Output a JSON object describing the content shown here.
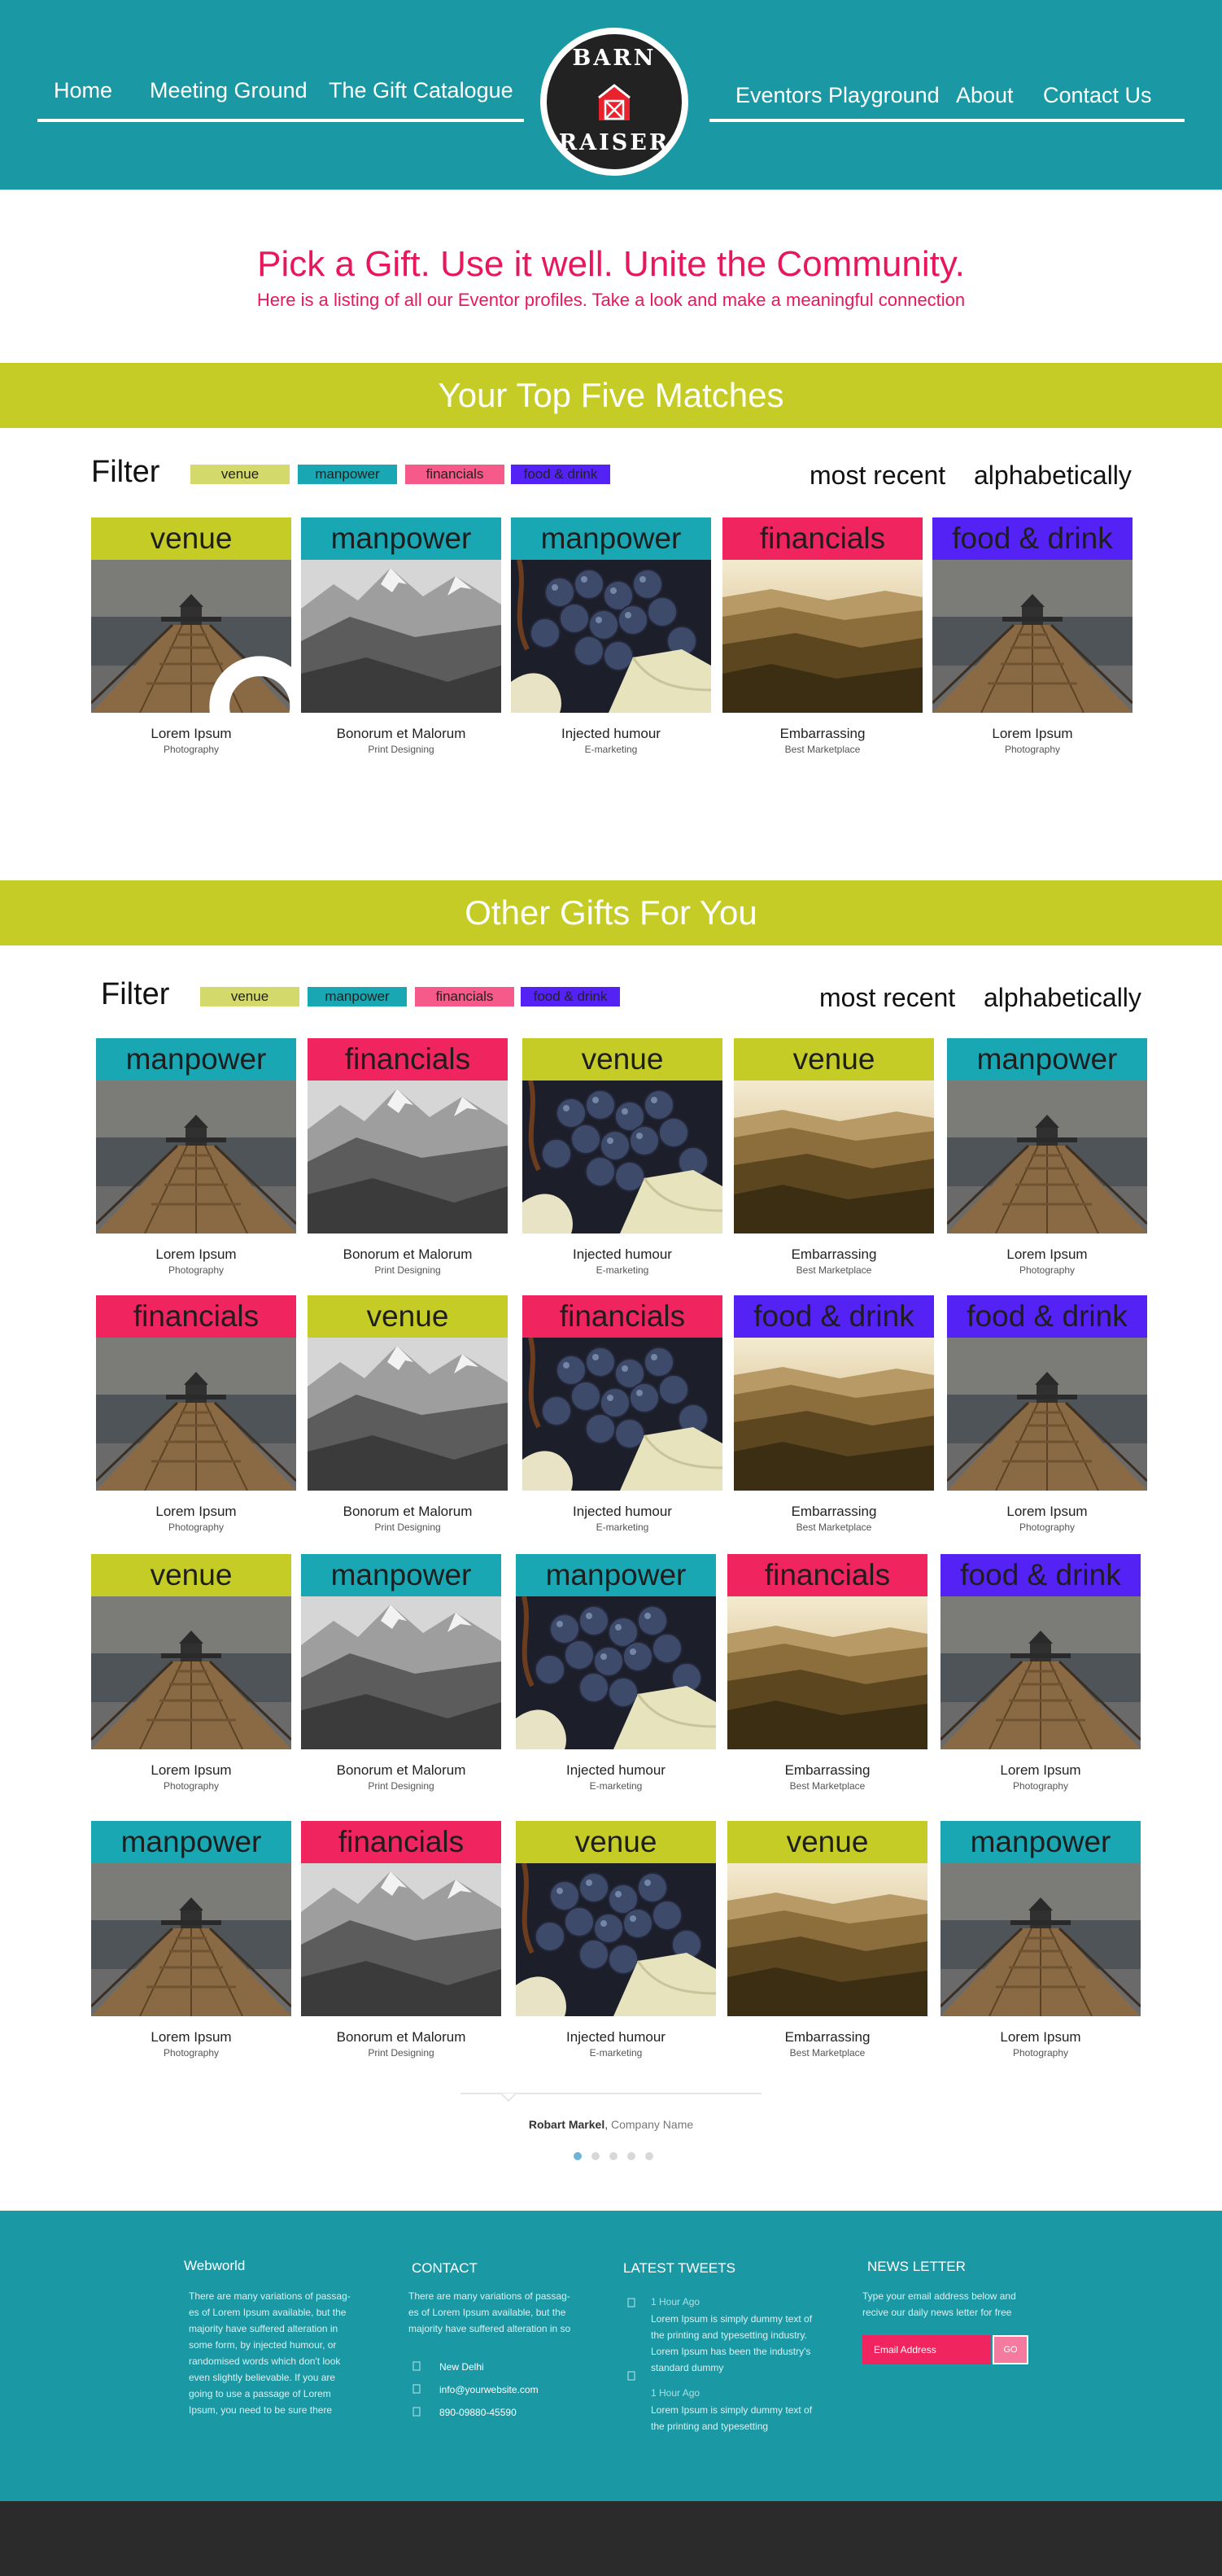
{
  "nav": {
    "home": "Home",
    "meeting": "Meeting Ground",
    "gift": "The Gift  Catalogue",
    "playground": "Eventors Playground",
    "about": "About",
    "contact": "Contact Us"
  },
  "logo": {
    "top_word": "BARN",
    "bottom_word": "RAISER"
  },
  "intro": {
    "headline": "Pick a Gift. Use it well. Unite the Community.",
    "subline": "Here is a listing of all our  Eventor profiles. Take a look and make a meaningful connection"
  },
  "colors": {
    "teal": "#1a98a4",
    "lime": "#c5cc26",
    "pink": "#e8175d",
    "venue": "#c5cc26",
    "manpower": "#1aa7b4",
    "financials": "#f0245e",
    "food": "#5522f5"
  },
  "filters": {
    "label": "Filter",
    "chips": [
      "venue",
      "manpower",
      "financials",
      "food & drink"
    ],
    "sort_recent": "most recent",
    "sort_alpha": "alphabetically"
  },
  "top_section": {
    "title": "Your Top Five Matches",
    "cards": [
      {
        "tag": "venue",
        "tag_color": "venue",
        "image": "pier",
        "title": "Lorem Ipsum",
        "subtitle": "Photography"
      },
      {
        "tag": "manpower",
        "tag_color": "manpower",
        "image": "mountains",
        "title": "Bonorum et Malorum",
        "subtitle": "Print Designing"
      },
      {
        "tag": "manpower",
        "tag_color": "manpower",
        "image": "grapes",
        "title": "Injected humour",
        "subtitle": "E-marketing"
      },
      {
        "tag": "financials",
        "tag_color": "financials",
        "image": "hills",
        "title": "Embarrassing",
        "subtitle": "Best Marketplace"
      },
      {
        "tag": "food & drink",
        "tag_color": "food",
        "image": "pier",
        "title": "Lorem Ipsum",
        "subtitle": "Photography"
      }
    ]
  },
  "other_section": {
    "title": "Other Gifts For You",
    "rows": [
      [
        {
          "tag": "manpower",
          "tag_color": "manpower",
          "image": "pier",
          "title": "Lorem Ipsum",
          "subtitle": "Photography"
        },
        {
          "tag": "financials",
          "tag_color": "financials",
          "image": "mountains",
          "title": "Bonorum et Malorum",
          "subtitle": "Print Designing"
        },
        {
          "tag": "venue",
          "tag_color": "venue",
          "image": "grapes",
          "title": "Injected humour",
          "subtitle": "E-marketing"
        },
        {
          "tag": "venue",
          "tag_color": "venue",
          "image": "hills",
          "title": "Embarrassing",
          "subtitle": "Best Marketplace"
        },
        {
          "tag": "manpower",
          "tag_color": "manpower",
          "image": "pier",
          "title": "Lorem Ipsum",
          "subtitle": "Photography"
        }
      ],
      [
        {
          "tag": "financials",
          "tag_color": "financials",
          "image": "pier",
          "title": "Lorem Ipsum",
          "subtitle": "Photography"
        },
        {
          "tag": "venue",
          "tag_color": "venue",
          "image": "mountains",
          "title": "Bonorum et Malorum",
          "subtitle": "Print Designing"
        },
        {
          "tag": "financials",
          "tag_color": "financials",
          "image": "grapes",
          "title": "Injected humour",
          "subtitle": "E-marketing"
        },
        {
          "tag": "food & drink",
          "tag_color": "food",
          "image": "hills",
          "title": "Embarrassing",
          "subtitle": "Best Marketplace"
        },
        {
          "tag": "food & drink",
          "tag_color": "food",
          "image": "pier",
          "title": "Lorem Ipsum",
          "subtitle": "Photography"
        }
      ],
      [
        {
          "tag": "venue",
          "tag_color": "venue",
          "image": "pier",
          "title": "Lorem Ipsum",
          "subtitle": "Photography"
        },
        {
          "tag": "manpower",
          "tag_color": "manpower",
          "image": "mountains",
          "title": "Bonorum et Malorum",
          "subtitle": "Print Designing"
        },
        {
          "tag": "manpower",
          "tag_color": "manpower",
          "image": "grapes",
          "title": "Injected humour",
          "subtitle": "E-marketing"
        },
        {
          "tag": "financials",
          "tag_color": "financials",
          "image": "hills",
          "title": "Embarrassing",
          "subtitle": "Best Marketplace"
        },
        {
          "tag": "food & drink",
          "tag_color": "food",
          "image": "pier",
          "title": "Lorem Ipsum",
          "subtitle": "Photography"
        }
      ],
      [
        {
          "tag": "manpower",
          "tag_color": "manpower",
          "image": "pier",
          "title": "Lorem Ipsum",
          "subtitle": "Photography"
        },
        {
          "tag": "financials",
          "tag_color": "financials",
          "image": "mountains",
          "title": "Bonorum et Malorum",
          "subtitle": "Print Designing"
        },
        {
          "tag": "venue",
          "tag_color": "venue",
          "image": "grapes",
          "title": "Injected humour",
          "subtitle": "E-marketing"
        },
        {
          "tag": "venue",
          "tag_color": "venue",
          "image": "hills",
          "title": "Embarrassing",
          "subtitle": "Best Marketplace"
        },
        {
          "tag": "manpower",
          "tag_color": "manpower",
          "image": "pier",
          "title": "Lorem Ipsum",
          "subtitle": "Photography"
        }
      ]
    ]
  },
  "testimonial": {
    "name": "Robart Markel",
    "company": "Company Name",
    "dots": 5
  },
  "footer": {
    "about": {
      "title": "Webworld",
      "text": "There are many variations of passag-es of Lorem Ipsum available, but the majority have suffered alteration in some form, by injected humour, or randomised words which don't look even slightly believable. If you are going to use a passage of Lorem Ipsum, you need to be sure there"
    },
    "contact": {
      "title": "CONTACT",
      "text": "There are many variations of passag-es of Lorem Ipsum available, but the majority have suffered alteration in so",
      "city": "New Delhi",
      "email": "info@yourwebsite.com",
      "phone": "890-09880-45590"
    },
    "tweets": {
      "title": "LATEST TWEETS",
      "items": [
        {
          "time": "1 Hour Ago",
          "text": "Lorem Ipsum is simply dummy text of the printing and typesetting industry. Lorem Ipsum has been the industry's standard dummy"
        },
        {
          "time": "1 Hour Ago",
          "text": "Lorem Ipsum is simply dummy text of the printing and typesetting"
        }
      ]
    },
    "newsletter": {
      "title": "NEWS LETTER",
      "text": "Type your email address below and recive our daily news letter for free",
      "placeholder": "Email Address",
      "button": "GO"
    }
  }
}
